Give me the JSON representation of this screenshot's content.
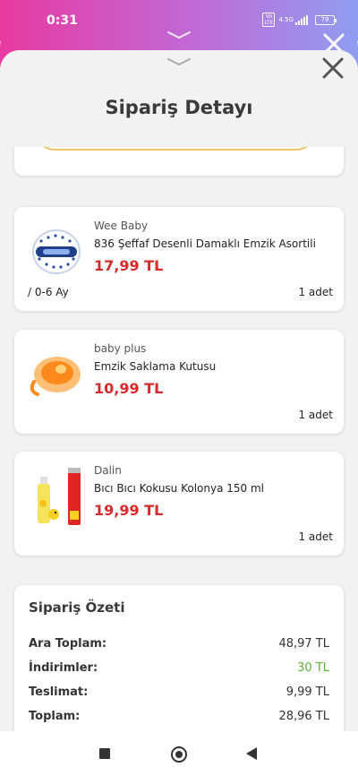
{
  "status_bar": {
    "time": "0:31",
    "network": "4.5G",
    "battery": "79"
  },
  "sheet": {
    "title": "Sipariş Detayı"
  },
  "products": [
    {
      "brand": "Wee Baby",
      "name": "836 Şeffaf Desenli Damaklı Emzik Asortili",
      "price": "17,99 TL",
      "variant": "/ 0-6 Ay",
      "quantity": "1 adet",
      "image_icon": "pacifier-image"
    },
    {
      "brand": "baby plus",
      "name": "Emzik Saklama Kutusu",
      "price": "10,99 TL",
      "variant": "",
      "quantity": "1 adet",
      "image_icon": "pacifier-case-image"
    },
    {
      "brand": "Dalin",
      "name": "Bıcı Bıcı Kokusu Kolonya 150 ml",
      "price": "19,99 TL",
      "variant": "",
      "quantity": "1 adet",
      "image_icon": "cologne-image"
    }
  ],
  "summary": {
    "title": "Sipariş Özeti",
    "rows": [
      {
        "label": "Ara Toplam:",
        "value": "48,97 TL"
      },
      {
        "label": "İndirimler:",
        "value": "30 TL"
      },
      {
        "label": "Teslimat:",
        "value": "9,99 TL"
      },
      {
        "label": "Toplam:",
        "value": "28,96 TL"
      }
    ]
  },
  "colors": {
    "price_red": "#d52b2b",
    "discount_green": "#5cb531",
    "accent_gradient_start": "#e83aa0",
    "accent_gradient_end": "#8f9ef0"
  }
}
